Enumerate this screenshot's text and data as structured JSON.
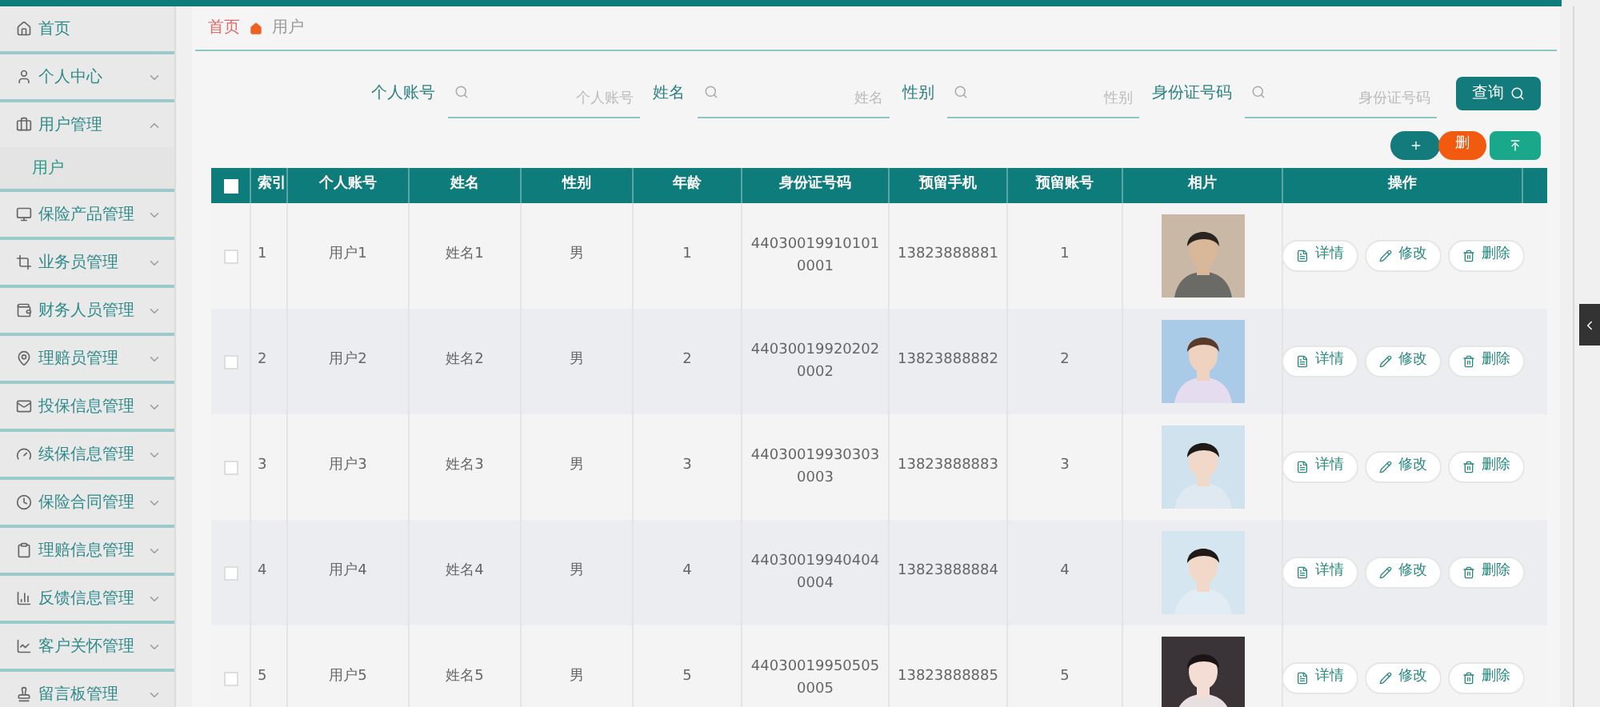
{
  "sidebar": {
    "items": [
      {
        "label": "首页"
      },
      {
        "label": "个人中心",
        "expanded": false
      },
      {
        "label": "用户管理",
        "expanded": true,
        "children": [
          {
            "label": "用户",
            "selected": true
          }
        ]
      },
      {
        "label": "保险产品管理",
        "expanded": false
      },
      {
        "label": "业务员管理",
        "expanded": false
      },
      {
        "label": "财务人员管理",
        "expanded": false
      },
      {
        "label": "理赔员管理",
        "expanded": false
      },
      {
        "label": "投保信息管理",
        "expanded": false
      },
      {
        "label": "续保信息管理",
        "expanded": false
      },
      {
        "label": "保险合同管理",
        "expanded": false
      },
      {
        "label": "理赔信息管理",
        "expanded": false
      },
      {
        "label": "反馈信息管理",
        "expanded": false
      },
      {
        "label": "客户关怀管理",
        "expanded": false
      },
      {
        "label": "留言板管理",
        "expanded": false
      }
    ]
  },
  "breadcrumb": [
    "首页",
    "用户"
  ],
  "search": {
    "fields": [
      {
        "label": "个人账号",
        "placeholder": "个人账号"
      },
      {
        "label": "姓名",
        "placeholder": "姓名"
      },
      {
        "label": "性别",
        "placeholder": "性别"
      },
      {
        "label": "身份证号码",
        "placeholder": "身份证号码"
      }
    ],
    "button": "查询"
  },
  "toolbar": {
    "delete_label": "删"
  },
  "table": {
    "header_checked": false,
    "columns": [
      "索引",
      "个人账号",
      "姓名",
      "性别",
      "年龄",
      "身份证号码",
      "预留手机",
      "预留账号",
      "相片",
      "操作"
    ],
    "rows": [
      {
        "checked": false,
        "cells": [
          "1",
          "用户1",
          "姓名1",
          "男",
          "1",
          "440300199101010001",
          "13823888881",
          "1"
        ],
        "photo": {
          "kind": "picture"
        },
        "actions": [
          "详情",
          "修改",
          "删除"
        ]
      },
      {
        "checked": false,
        "cells": [
          "2",
          "用户2",
          "姓名2",
          "男",
          "2",
          "440300199202020002",
          "13823888882",
          "2"
        ],
        "photo": {
          "kind": "picture"
        },
        "actions": [
          "详情",
          "修改",
          "删除"
        ]
      },
      {
        "checked": false,
        "cells": [
          "3",
          "用户3",
          "姓名3",
          "男",
          "3",
          "440300199303030003",
          "13823888883",
          "3"
        ],
        "photo": {
          "kind": "picture"
        },
        "actions": [
          "详情",
          "修改",
          "删除"
        ]
      },
      {
        "checked": false,
        "cells": [
          "4",
          "用户4",
          "姓名4",
          "男",
          "4",
          "440300199404040004",
          "13823888884",
          "4"
        ],
        "photo": {
          "kind": "picture"
        },
        "actions": [
          "详情",
          "修改",
          "删除"
        ]
      },
      {
        "checked": false,
        "cells": [
          "5",
          "用户5",
          "姓名5",
          "男",
          "5",
          "440300199505050005",
          "13823888885",
          "5"
        ],
        "photo": {
          "kind": "picture"
        },
        "actions": [
          "详情",
          "修改",
          "删除"
        ]
      }
    ]
  }
}
